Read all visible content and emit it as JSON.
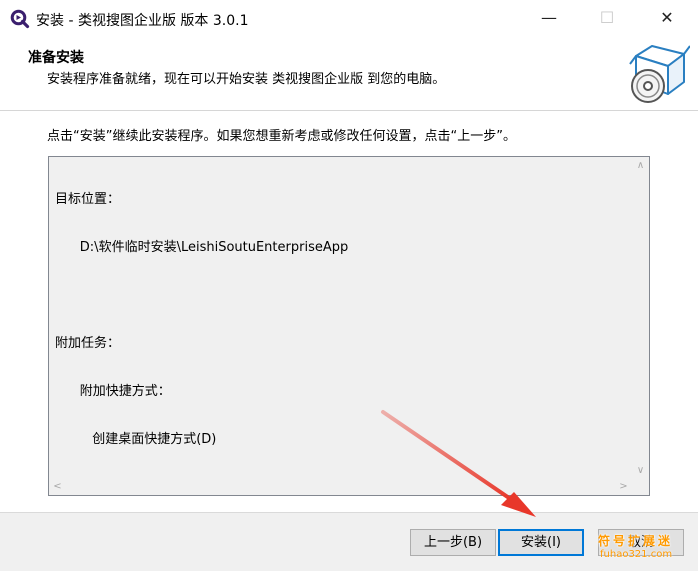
{
  "window": {
    "title": "安装 - 类视搜图企业版 版本 3.0.1",
    "minimize_glyph": "—",
    "maximize_glyph": "☐",
    "close_glyph": "✕"
  },
  "header": {
    "title": "准备安装",
    "subtitle": "安装程序准备就绪，现在可以开始安装 类视搜图企业版 到您的电脑。"
  },
  "instruction": "点击“安装”继续此安装程序。如果您想重新考虑或修改任何设置，点击“上一步”。",
  "memo": {
    "lines": [
      "目标位置：",
      "      D:\\软件临时安装\\LeishiSoutuEnterpriseApp",
      "",
      "附加任务：",
      "      附加快捷方式：",
      "         创建桌面快捷方式(D)"
    ]
  },
  "scrollbar": {
    "up": "∧",
    "down": "∨",
    "left": "<",
    "right": ">"
  },
  "buttons": {
    "back": "上一步(B)",
    "install": "安装(I)",
    "cancel": "取消"
  },
  "watermark": {
    "line1": "符号扩展迷",
    "line2": "fuhao321.com"
  },
  "colors": {
    "accent": "#0078d7",
    "arrow": "#e8372a",
    "app_icon": "#3b1f6e"
  },
  "icons": {
    "app": "magnifier-app-icon",
    "header": "install-box-disc-icon"
  }
}
